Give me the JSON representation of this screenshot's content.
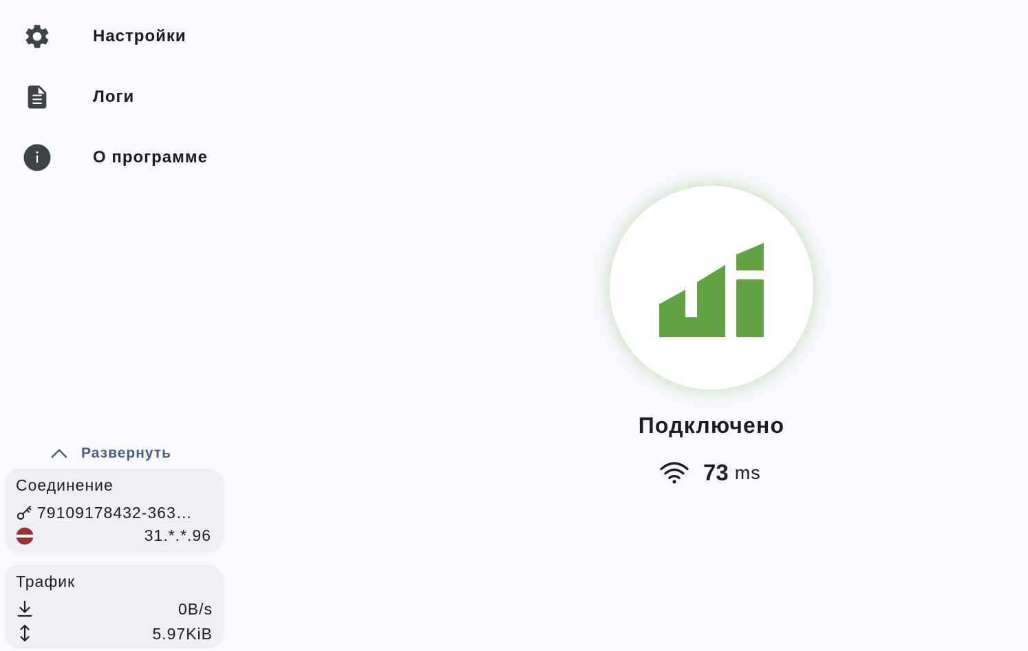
{
  "sidebar": {
    "items": [
      {
        "label": "Настройки",
        "icon": "gear-icon"
      },
      {
        "label": "Логи",
        "icon": "document-icon"
      },
      {
        "label": "О программе",
        "icon": "info-icon"
      }
    ],
    "expand_label": "Развернуть"
  },
  "connection": {
    "title": "Соединение",
    "profile": "79109178432-363…",
    "address": "31.*.*.96",
    "flag_icon": "latvia-flag-icon"
  },
  "traffic": {
    "title": "Трафик",
    "speed": "0B/s",
    "total": "5.97KiB"
  },
  "status": {
    "label": "Подключено",
    "latency_value": "73",
    "latency_unit": "ms"
  },
  "colors": {
    "background": "#f9f9fe",
    "accent_green": "#62a243",
    "icon_dark": "#3e4249",
    "link_blue": "#4a5d8a",
    "card_background": "#eff0f5"
  }
}
